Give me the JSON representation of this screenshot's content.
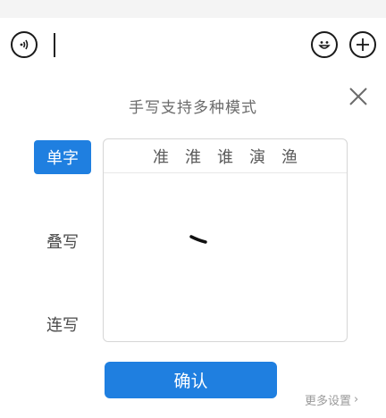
{
  "input_bar": {
    "voice_icon": "voice-input-icon",
    "emoji_icon": "emoji-icon",
    "plus_icon": "plus-icon"
  },
  "handwriting": {
    "hint": "手写支持多种模式",
    "close_icon": "close-icon",
    "modes": [
      {
        "label": "单字",
        "active": true
      },
      {
        "label": "叠写",
        "active": false
      },
      {
        "label": "连写",
        "active": false
      }
    ],
    "candidates": [
      "准",
      "淮",
      "谁",
      "演",
      "渔"
    ],
    "confirm_label": "确认",
    "more_settings": "更多设置",
    "more_chevron": "›"
  },
  "colors": {
    "accent": "#1f7fe0",
    "hint_text": "#6b6b6b",
    "muted": "#9a9a9a"
  }
}
